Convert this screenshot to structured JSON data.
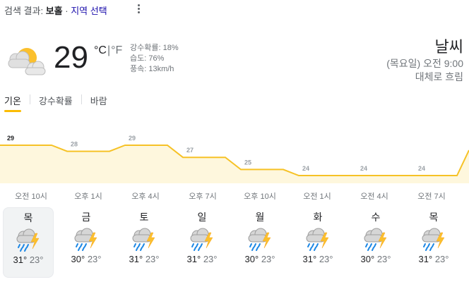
{
  "search": {
    "prefix": "검색 결과:",
    "query": "보홀",
    "dot": "·",
    "location_link": "지역 선택"
  },
  "current": {
    "temperature": "29",
    "unit_c": "°C",
    "unit_sep": "|",
    "unit_f": "°F",
    "details": [
      "강수확률: 18%",
      "습도: 76%",
      "풍속: 13km/h"
    ],
    "icon": "partly-cloudy-day-icon"
  },
  "header": {
    "title": "날씨",
    "day_time": "(목요일) 오전 9:00",
    "condition": "대체로 흐림"
  },
  "tabs": [
    {
      "label": "기온",
      "active": true
    },
    {
      "label": "강수확률",
      "active": false
    },
    {
      "label": "바람",
      "active": false
    }
  ],
  "chart_data": {
    "type": "area",
    "x": [
      "오전 10시",
      "오후 1시",
      "오후 4시",
      "오후 7시",
      "오후 10시",
      "오전 1시",
      "오전 4시",
      "오전 7시"
    ],
    "values": [
      29,
      28,
      29,
      27,
      25,
      24,
      24,
      24
    ],
    "data_labels": [
      "29",
      "28",
      "29",
      "27",
      "25",
      "24",
      "24",
      "24"
    ],
    "colors": {
      "line": "#f6c226",
      "fill": "#fef7dd",
      "highlight_label": "#202124",
      "label": "#9aa0a6"
    }
  },
  "days": [
    {
      "day": "목",
      "high": "31°",
      "low": "23°",
      "icon": "thunderstorm-rain-icon",
      "selected": true
    },
    {
      "day": "금",
      "high": "30°",
      "low": "23°",
      "icon": "thunderstorm-rain-icon"
    },
    {
      "day": "토",
      "high": "31°",
      "low": "23°",
      "icon": "thunderstorm-rain-icon"
    },
    {
      "day": "일",
      "high": "31°",
      "low": "23°",
      "icon": "thunderstorm-rain-icon"
    },
    {
      "day": "월",
      "high": "30°",
      "low": "23°",
      "icon": "thunderstorm-rain-icon"
    },
    {
      "day": "화",
      "high": "31°",
      "low": "23°",
      "icon": "thunderstorm-rain-icon"
    },
    {
      "day": "수",
      "high": "30°",
      "low": "23°",
      "icon": "thunderstorm-rain-icon"
    },
    {
      "day": "목",
      "high": "31°",
      "low": "23°",
      "icon": "thunderstorm-rain-icon"
    }
  ]
}
